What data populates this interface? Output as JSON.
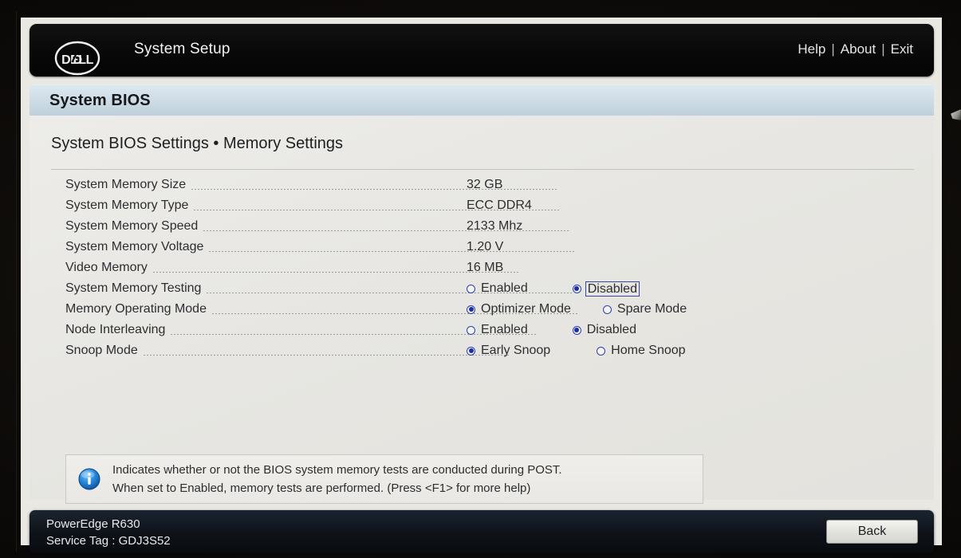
{
  "header": {
    "logo_alt": "Dell",
    "title": "System Setup",
    "links": [
      {
        "label": "Help"
      },
      {
        "label": "About"
      },
      {
        "label": "Exit"
      }
    ],
    "separator": "|"
  },
  "band": {
    "title": "System BIOS"
  },
  "page": {
    "breadcrumb": "System BIOS Settings • Memory Settings"
  },
  "settings": [
    {
      "label": "System Memory Size",
      "type": "text",
      "value": "32 GB"
    },
    {
      "label": "System Memory Type",
      "type": "text",
      "value": "ECC DDR4"
    },
    {
      "label": "System Memory Speed",
      "type": "text",
      "value": "2133 Mhz"
    },
    {
      "label": "System Memory Voltage",
      "type": "text",
      "value": "1.20 V"
    },
    {
      "label": "Video Memory",
      "type": "text",
      "value": "16 MB"
    },
    {
      "label": "System Memory Testing",
      "type": "radio",
      "options": [
        {
          "label": "Enabled",
          "selected": false,
          "focused": false,
          "gap": 0
        },
        {
          "label": "Disabled",
          "selected": true,
          "focused": true,
          "gap": 56
        }
      ]
    },
    {
      "label": "Memory Operating Mode",
      "type": "radio",
      "options": [
        {
          "label": "Optimizer Mode",
          "selected": true,
          "focused": false,
          "gap": 0
        },
        {
          "label": "Spare Mode",
          "selected": false,
          "focused": false,
          "gap": 40
        }
      ]
    },
    {
      "label": "Node Interleaving",
      "type": "radio",
      "options": [
        {
          "label": "Enabled",
          "selected": false,
          "focused": false,
          "gap": 0
        },
        {
          "label": "Disabled",
          "selected": true,
          "focused": false,
          "gap": 56
        }
      ]
    },
    {
      "label": "Snoop Mode",
      "type": "radio",
      "options": [
        {
          "label": "Early Snoop",
          "selected": true,
          "focused": false,
          "gap": 0
        },
        {
          "label": "Home Snoop",
          "selected": false,
          "focused": false,
          "gap": 58
        }
      ]
    }
  ],
  "help": {
    "icon": "info-icon",
    "line1": "Indicates whether or not the BIOS system memory tests are conducted during POST.",
    "line2": "When set to Enabled, memory tests are performed. (Press <F1> for more help)"
  },
  "footer": {
    "model": "PowerEdge R630",
    "service_tag": "Service Tag : GDJ3S52",
    "back_label": "Back"
  },
  "colors": {
    "accent_blue": "#1a2ea8",
    "band_blue": "#cfdde7",
    "header_black": "#0b0b0b",
    "content_bg": "#e7e6e2",
    "info_blue": "#1d7fd4"
  }
}
